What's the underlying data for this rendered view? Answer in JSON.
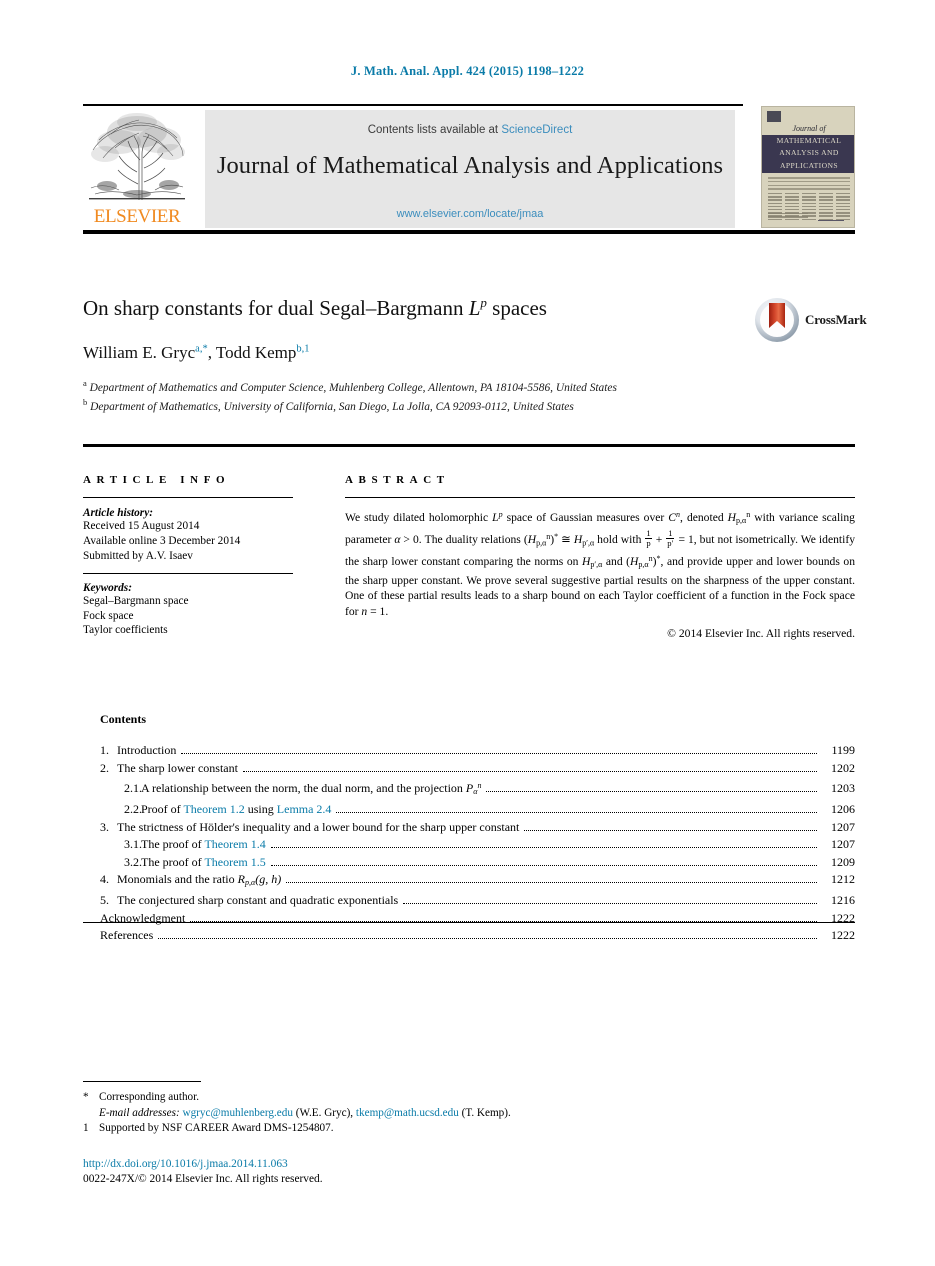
{
  "running_head": "J. Math. Anal. Appl. 424 (2015) 1198–1222",
  "masthead": {
    "publisher_wordmark": "ELSEVIER",
    "contents_prefix": "Contents lists available at",
    "sciencedirect": "ScienceDirect",
    "journal_title": "Journal of Mathematical Analysis and Applications",
    "journal_url": "www.elsevier.com/locate/jmaa",
    "cover": {
      "journal_of": "Journal of",
      "line1": "MATHEMATICAL",
      "line2": "ANALYSIS AND",
      "line3": "APPLICATIONS"
    },
    "link_color": "#3b8dbd"
  },
  "article": {
    "title_main": "On sharp constants for dual Segal–Bargmann ",
    "title_math": "L",
    "title_math_sup": "p",
    "title_tail": " spaces",
    "crossmark_label": "CrossMark",
    "authors_html": "William E. Gryc",
    "author1": "William E. Gryc",
    "author1_marks": "a,*",
    "author2": "Todd Kemp",
    "author2_marks": "b,1",
    "affiliation_a_mark": "a",
    "affiliation_a": "Department of Mathematics and Computer Science, Muhlenberg College, Allentown, PA 18104-5586, United States",
    "affiliation_b_mark": "b",
    "affiliation_b": "Department of Mathematics, University of California, San Diego, La Jolla, CA 92093-0112, United States"
  },
  "article_info": {
    "heading": "ARTICLE INFO",
    "history_label": "Article history:",
    "received": "Received 15 August 2014",
    "available_online": "Available online 3 December 2014",
    "submitted_by": "Submitted by A.V. Isaev",
    "keywords_label": "Keywords:",
    "keywords": [
      "Segal–Bargmann space",
      "Fock space",
      "Taylor coefficients"
    ]
  },
  "abstract": {
    "heading": "ABSTRACT",
    "copyright": "© 2014 Elsevier Inc. All rights reserved.",
    "text_plain": "We study dilated holomorphic Lp space of Gaussian measures over Cn, denoted Hnp,α with variance scaling parameter α > 0. The duality relations (Hnp,α)* ≅ Hp′,α hold with 1/p + 1/p′ = 1, but not isometrically. We identify the sharp lower constant comparing the norms on Hp′,α and (Hnp,α)*, and provide upper and lower bounds on the sharp upper constant. We prove several suggestive partial results on the sharpness of the upper constant. One of these partial results leads to a sharp bound on each Taylor coefficient of a function in the Fock space for n = 1."
  },
  "contents": {
    "heading": "Contents",
    "entries": [
      {
        "num": "1.",
        "level": 1,
        "label": "Introduction",
        "page": "1199"
      },
      {
        "num": "2.",
        "level": 1,
        "label": "The sharp lower constant",
        "page": "1202"
      },
      {
        "num": "2.1.",
        "level": 2,
        "label": "A relationship between the norm, the dual norm, and the projection",
        "page": "1203",
        "math": "P",
        "math_sub": "α",
        "math_sup": "n"
      },
      {
        "num": "2.2.",
        "level": 2,
        "label_pre": "Proof of ",
        "link1": "Theorem 1.2",
        "label_mid": " using ",
        "link2": "Lemma 2.4",
        "page": "1206"
      },
      {
        "num": "3.",
        "level": 1,
        "label": "The strictness of Hölder's inequality and a lower bound for the sharp upper constant",
        "page": "1207"
      },
      {
        "num": "3.1.",
        "level": 2,
        "label_pre": "The proof of ",
        "link1": "Theorem 1.4",
        "page": "1207"
      },
      {
        "num": "3.2.",
        "level": 2,
        "label_pre": "The proof of ",
        "link1": "Theorem 1.5",
        "page": "1209"
      },
      {
        "num": "4.",
        "level": 1,
        "label_pre": "Monomials and the ratio ",
        "math": "R",
        "math_sub": "p,α",
        "math_args": "(g, h)",
        "page": "1212"
      },
      {
        "num": "5.",
        "level": 1,
        "label": "The conjectured sharp constant and quadratic exponentials",
        "page": "1216"
      },
      {
        "num": "",
        "level": 0,
        "label": "Acknowledgment",
        "page": "1222"
      },
      {
        "num": "",
        "level": 0,
        "label": "References",
        "page": "1222"
      }
    ]
  },
  "footnotes": {
    "corresponding_mark": "*",
    "corresponding": "Corresponding author.",
    "emails_label": "E-mail addresses:",
    "email1": "wgryc@muhlenberg.edu",
    "email1_owner": "(W.E. Gryc),",
    "email2": "tkemp@math.ucsd.edu",
    "email2_owner": "(T. Kemp).",
    "support_mark": "1",
    "support": "Supported by NSF CAREER Award DMS-1254807.",
    "doi": "http://dx.doi.org/10.1016/j.jmaa.2014.11.063",
    "issn_line": "0022-247X/© 2014 Elsevier Inc. All rights reserved."
  }
}
